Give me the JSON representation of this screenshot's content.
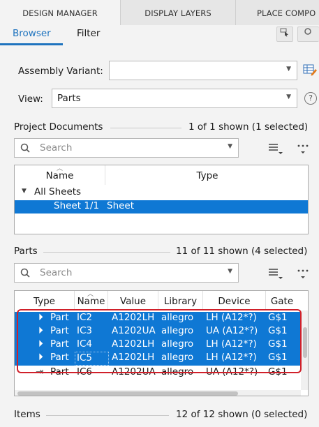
{
  "tabs": [
    "DESIGN MANAGER",
    "DISPLAY LAYERS",
    "PLACE COMPO"
  ],
  "subtabs": [
    "Browser",
    "Filter"
  ],
  "assembly": {
    "label": "Assembly Variant:",
    "value": ""
  },
  "view": {
    "label": "View:",
    "value": "Parts"
  },
  "project": {
    "label": "Project Documents",
    "status": "1 of 1 shown (1 selected)",
    "search_placeholder": "Search",
    "columns": [
      "Name",
      "Type"
    ],
    "tree_root": "All Sheets",
    "item_name": "Sheet 1/1",
    "item_type": "Sheet"
  },
  "parts": {
    "label": "Parts",
    "status": "11 of 11 shown (4 selected)",
    "search_placeholder": "Search",
    "columns": [
      "Type",
      "Name",
      "Value",
      "Library",
      "Device",
      "Gate"
    ],
    "rows": [
      {
        "type": "Part",
        "name": "IC2",
        "value": "A1202LH",
        "library": "allegro",
        "device": "LH (A12*?)",
        "gate": "G$1",
        "selected": true
      },
      {
        "type": "Part",
        "name": "IC3",
        "value": "A1202UA",
        "library": "allegro",
        "device": "UA (A12*?)",
        "gate": "G$1",
        "selected": true
      },
      {
        "type": "Part",
        "name": "IC4",
        "value": "A1202LH",
        "library": "allegro",
        "device": "LH (A12*?)",
        "gate": "G$1",
        "selected": true
      },
      {
        "type": "Part",
        "name": "IC5",
        "value": "A1202LH",
        "library": "allegro",
        "device": "LH (A12*?)",
        "gate": "G$1",
        "selected": true
      },
      {
        "type": "Part",
        "name": "IC6",
        "value": "A1202UA",
        "library": "allegro",
        "device": "UA (A12*?)",
        "gate": "G$1",
        "selected": false
      }
    ]
  },
  "items": {
    "label": "Items",
    "status": "12 of 12 shown (0 selected)"
  },
  "colors": {
    "accent": "#1e73be",
    "selection": "#0f78d4",
    "highlight_outline": "#d0202a"
  }
}
